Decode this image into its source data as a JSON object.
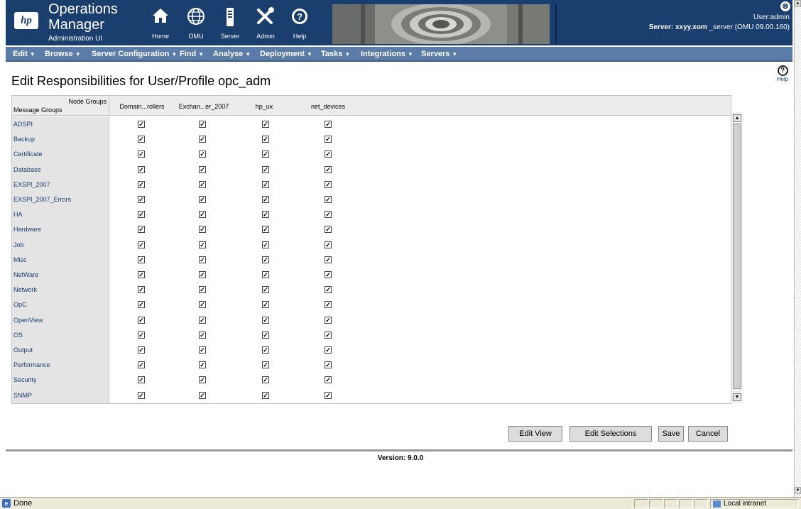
{
  "header": {
    "logo_text": "hp",
    "title_line1": "Operations",
    "title_line2": "Manager",
    "subtitle": "Administration UI",
    "nav": [
      {
        "label": "Home",
        "icon": "home-icon"
      },
      {
        "label": "OMU",
        "icon": "globe-icon"
      },
      {
        "label": "Server",
        "icon": "server-icon"
      },
      {
        "label": "Admin",
        "icon": "tools-icon"
      },
      {
        "label": "Help",
        "icon": "help-icon"
      }
    ],
    "user_text": "User:admin",
    "server_prefix": "Server: xxyy.xom",
    "server_suffix": " _server (OMU 09.00.160)",
    "close_symbol": "⊗"
  },
  "menubar": [
    {
      "label": "Edit"
    },
    {
      "label": "Browse"
    },
    {
      "label": "Server Configuration"
    },
    {
      "label": "Find"
    },
    {
      "label": "Analyse"
    },
    {
      "label": "Deployment"
    },
    {
      "label": "Tasks"
    },
    {
      "label": "Integrations"
    },
    {
      "label": "Servers"
    }
  ],
  "page": {
    "title": "Edit Responsibilities for User/Profile opc_adm",
    "help_label": "Help"
  },
  "grid": {
    "corner_node_groups": "Node Groups",
    "corner_message_groups": "Message Groups",
    "columns": [
      "Domain...rollers",
      "Exchan...er_2007",
      "hp_ux",
      "net_devices"
    ],
    "rows": [
      {
        "name": "ADSPI",
        "checked": [
          true,
          true,
          true,
          true
        ]
      },
      {
        "name": "Backup",
        "checked": [
          true,
          true,
          true,
          true
        ]
      },
      {
        "name": "Certificate",
        "checked": [
          true,
          true,
          true,
          true
        ]
      },
      {
        "name": "Database",
        "checked": [
          true,
          true,
          true,
          true
        ]
      },
      {
        "name": "EXSPI_2007",
        "checked": [
          true,
          true,
          true,
          true
        ]
      },
      {
        "name": "EXSPI_2007_Errors",
        "checked": [
          true,
          true,
          true,
          true
        ]
      },
      {
        "name": "HA",
        "checked": [
          true,
          true,
          true,
          true
        ]
      },
      {
        "name": "Hardware",
        "checked": [
          true,
          true,
          true,
          true
        ]
      },
      {
        "name": "Job",
        "checked": [
          true,
          true,
          true,
          true
        ]
      },
      {
        "name": "Misc",
        "checked": [
          true,
          true,
          true,
          true
        ]
      },
      {
        "name": "NetWare",
        "checked": [
          true,
          true,
          true,
          true
        ]
      },
      {
        "name": "Network",
        "checked": [
          true,
          true,
          true,
          true
        ]
      },
      {
        "name": "OpC",
        "checked": [
          true,
          true,
          true,
          true
        ]
      },
      {
        "name": "OpenView",
        "checked": [
          true,
          true,
          true,
          true
        ]
      },
      {
        "name": "OS",
        "checked": [
          true,
          true,
          true,
          true
        ]
      },
      {
        "name": "Output",
        "checked": [
          true,
          true,
          true,
          true
        ]
      },
      {
        "name": "Performance",
        "checked": [
          true,
          true,
          true,
          true
        ]
      },
      {
        "name": "Security",
        "checked": [
          true,
          true,
          true,
          true
        ]
      },
      {
        "name": "SNMP",
        "checked": [
          true,
          true,
          true,
          true
        ]
      }
    ],
    "check_glyph": "✓"
  },
  "buttons": {
    "edit_view": "Edit View",
    "edit_selections": "Edit Selections",
    "save": "Save",
    "cancel": "Cancel"
  },
  "footer": {
    "version": "Version: 9.0.0"
  },
  "statusbar": {
    "text": "Done",
    "zone": "Local intranet"
  },
  "colors": {
    "header_bg": "#1a3e6e",
    "menubar_bg": "#5b7ca8",
    "row_label_color": "#1a3e6e"
  }
}
